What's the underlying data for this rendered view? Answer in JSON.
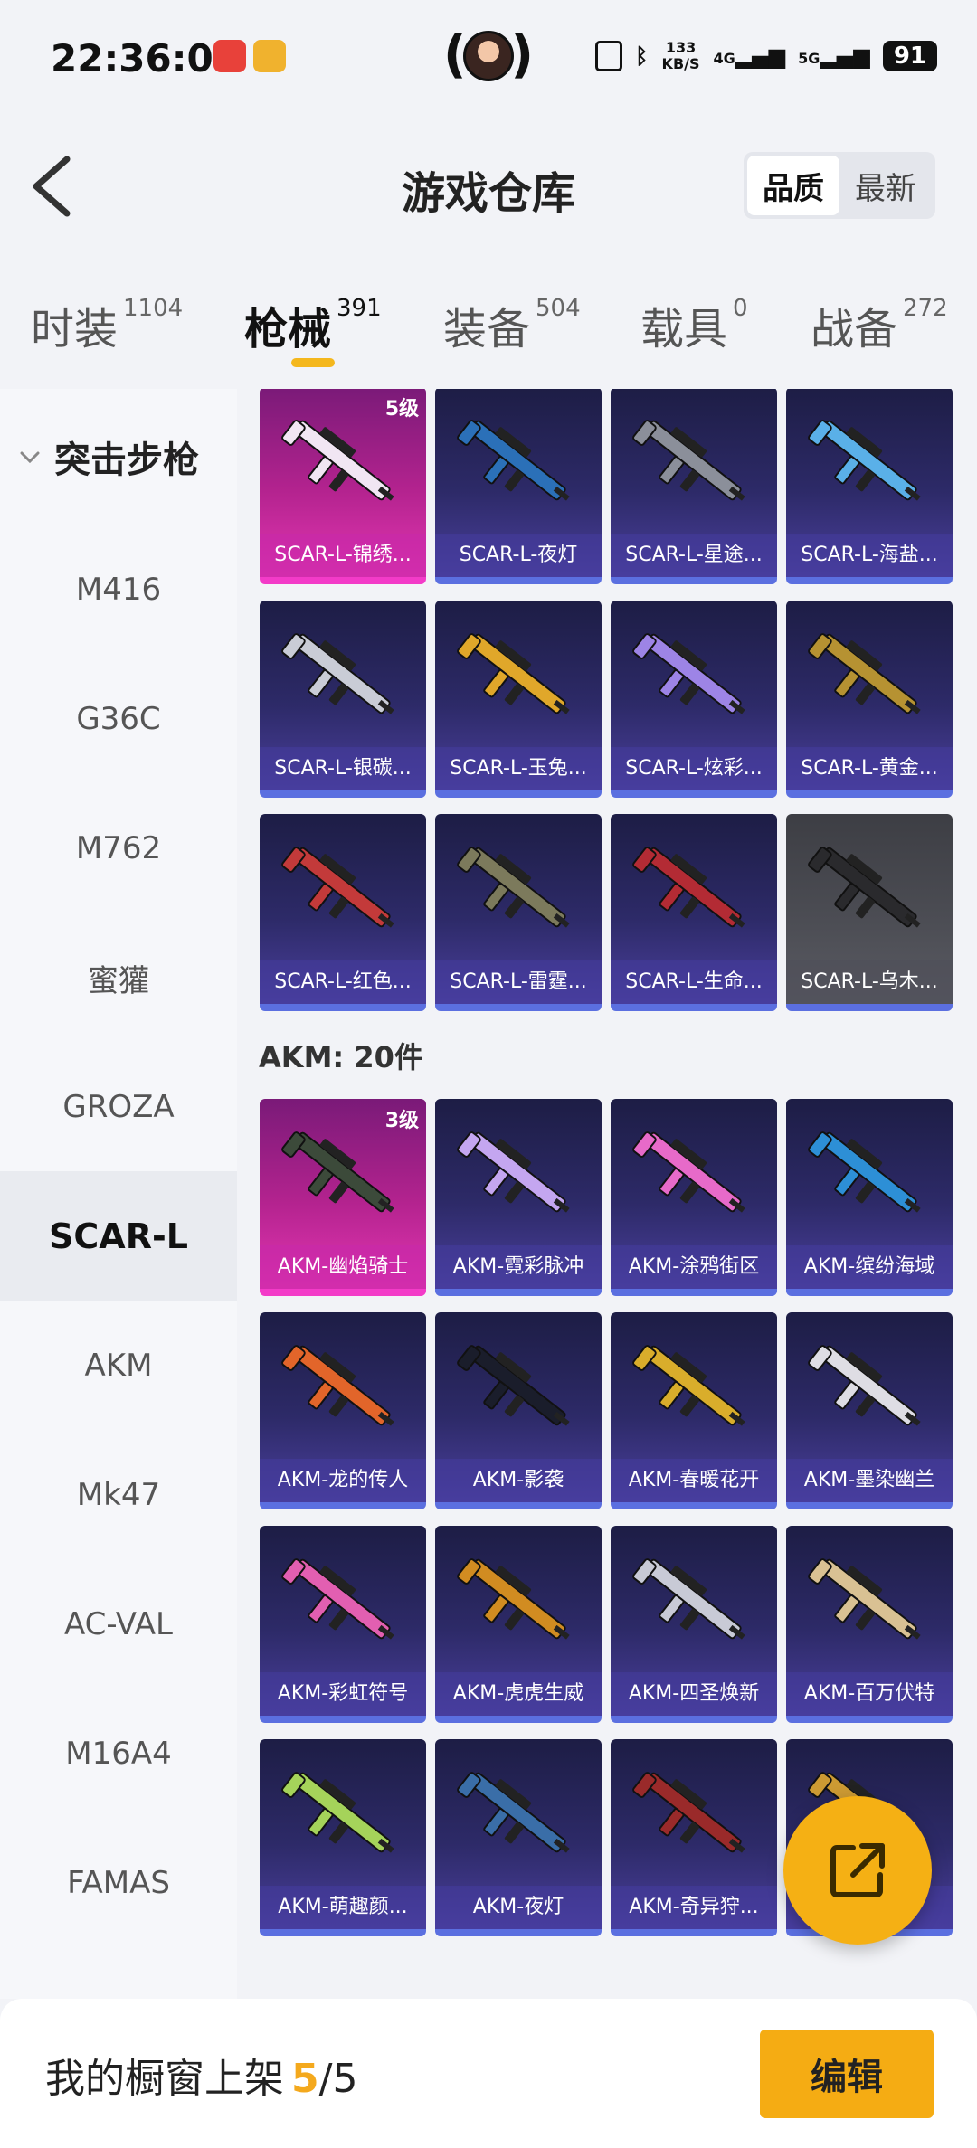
{
  "status_bar": {
    "time": "22:36:03",
    "net_speed": "133 KB/S",
    "signal_1": "4G",
    "signal_2": "5G",
    "battery": "91"
  },
  "header": {
    "title": "游戏仓库",
    "sort_options": [
      "品质",
      "最新"
    ],
    "sort_active": "品质"
  },
  "category_tabs": [
    {
      "label": "时装",
      "count": "1104"
    },
    {
      "label": "枪械",
      "count": "391"
    },
    {
      "label": "装备",
      "count": "504"
    },
    {
      "label": "载具",
      "count": "0"
    },
    {
      "label": "战备",
      "count": "272"
    }
  ],
  "active_tab": "枪械",
  "sidebar": {
    "group_label": "突击步枪",
    "items": [
      "M416",
      "G36C",
      "M762",
      "蜜獾",
      "GROZA",
      "SCAR-L",
      "AKM",
      "Mk47",
      "AC-VAL",
      "M16A4",
      "FAMAS"
    ],
    "active": "SCAR-L"
  },
  "scar_items": [
    {
      "name": "SCAR-L-锦绣...",
      "level": "5级",
      "tier": "gold",
      "color": "#f1e6f3"
    },
    {
      "name": "SCAR-L-夜灯",
      "tier": "blue",
      "color": "#2b70b8"
    },
    {
      "name": "SCAR-L-星途...",
      "tier": "blue",
      "color": "#8b8f9a"
    },
    {
      "name": "SCAR-L-海盐...",
      "tier": "blue",
      "color": "#5ab0e8"
    },
    {
      "name": "SCAR-L-银碳...",
      "tier": "blue",
      "color": "#c9ccd6"
    },
    {
      "name": "SCAR-L-玉兔...",
      "tier": "blue",
      "color": "#e0a72a"
    },
    {
      "name": "SCAR-L-炫彩...",
      "tier": "blue",
      "color": "#9d84e6"
    },
    {
      "name": "SCAR-L-黄金...",
      "tier": "blue",
      "color": "#b69232"
    },
    {
      "name": "SCAR-L-红色...",
      "tier": "blue",
      "color": "#c33a3a"
    },
    {
      "name": "SCAR-L-雷霆...",
      "tier": "blue",
      "color": "#7c7a5c"
    },
    {
      "name": "SCAR-L-生命...",
      "tier": "blue",
      "color": "#b32b34"
    },
    {
      "name": "SCAR-L-乌木...",
      "tier": "gray",
      "color": "#2a2a2d"
    }
  ],
  "akm_section_title": "AKM: 20件",
  "akm_items": [
    {
      "name": "AKM-幽焰骑士",
      "level": "3级",
      "tier": "gold",
      "color": "#3c4a3a"
    },
    {
      "name": "AKM-霓彩脉冲",
      "tier": "blue",
      "color": "#c4a6f0"
    },
    {
      "name": "AKM-涂鸦街区",
      "tier": "blue",
      "color": "#e76ac9"
    },
    {
      "name": "AKM-缤纷海域",
      "tier": "blue",
      "color": "#2d8fd6"
    },
    {
      "name": "AKM-龙的传人",
      "tier": "blue",
      "color": "#e2652a"
    },
    {
      "name": "AKM-影袭",
      "tier": "blue",
      "color": "#1a1d2b"
    },
    {
      "name": "AKM-春暖花开",
      "tier": "blue",
      "color": "#d9ad2b"
    },
    {
      "name": "AKM-墨染幽兰",
      "tier": "blue",
      "color": "#dedde4"
    },
    {
      "name": "AKM-彩虹符号",
      "tier": "blue",
      "color": "#e25fb1"
    },
    {
      "name": "AKM-虎虎生威",
      "tier": "blue",
      "color": "#d18c21"
    },
    {
      "name": "AKM-四圣焕新",
      "tier": "blue",
      "color": "#c8cad6"
    },
    {
      "name": "AKM-百万伏特",
      "tier": "blue",
      "color": "#d9c193"
    },
    {
      "name": "AKM-萌趣颜...",
      "tier": "blue",
      "color": "#a5d35a"
    },
    {
      "name": "AKM-夜灯",
      "tier": "blue",
      "color": "#3a6ea8"
    },
    {
      "name": "AKM-奇异狩...",
      "tier": "blue",
      "color": "#9a2a2a"
    },
    {
      "name": "",
      "tier": "blue",
      "color": "#cc9a33"
    }
  ],
  "bottom_bar": {
    "shelf_label": "我的橱窗上架",
    "shelf_count": "5",
    "shelf_sep": "/",
    "shelf_total": "5",
    "edit_label": "编辑"
  }
}
